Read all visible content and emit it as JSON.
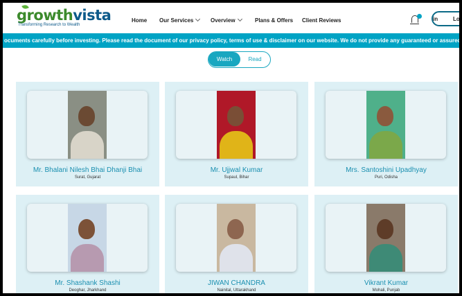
{
  "brand": {
    "name_part1": "growth",
    "name_part2": "vista",
    "tagline": "Transforming Research to Wealth"
  },
  "nav": {
    "home": "Home",
    "services": "Our Services",
    "overview": "Overview",
    "plans": "Plans & Offers",
    "reviews": "Client Reviews",
    "signin_partial": "in",
    "login_partial": "Lo"
  },
  "ticker": "ocuments carefully before investing. Please read the document of our privacy policy, terms of use & disclaimer on our website. We do not provide any guaranteed or assured return services, profi",
  "toggle": {
    "watch": "Watch",
    "read": "Read"
  },
  "colors": {
    "accent": "#00a3c4",
    "card_bg": "#ddf0f5",
    "name_text": "#1a8fb0",
    "brand_green": "#3c8a2c",
    "brand_blue": "#0d5a8a"
  },
  "reviews": [
    {
      "name": "Mr. Bhalani Nilesh Bhai Dhanji Bhai",
      "location": "Surat, Gujarat"
    },
    {
      "name": "Mr. Ujjwal Kumar",
      "location": "Supaul, Bihar"
    },
    {
      "name": "Mrs. Santoshini Upadhyay",
      "location": "Puri, Odisha"
    },
    {
      "name": "Mr. Shashank Shashi",
      "location": "Deoghar, Jharkhand"
    },
    {
      "name": "JIWAN CHANDRA",
      "location": "Nainital, Uttarakhand"
    },
    {
      "name": "Vikrant Kumar",
      "location": "Mohali, Punjab"
    }
  ]
}
